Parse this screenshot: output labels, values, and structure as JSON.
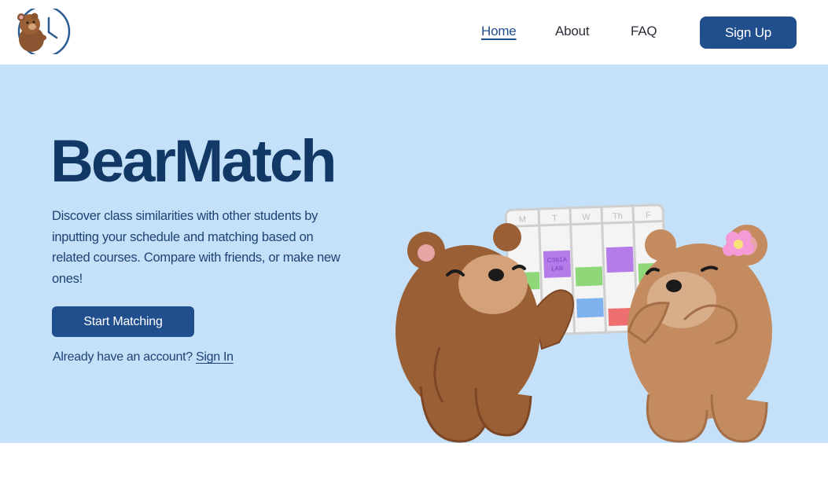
{
  "nav": {
    "logo_icon": "bear-with-clock-logo",
    "links": [
      {
        "label": "Home",
        "active": true
      },
      {
        "label": "About",
        "active": false
      },
      {
        "label": "FAQ",
        "active": false
      }
    ],
    "signup_label": "Sign Up"
  },
  "hero": {
    "title": "BearMatch",
    "description": "Discover class similarities with other students by inputting your schedule and matching based on related courses. Compare with friends, or make new ones!",
    "start_button": "Start Matching",
    "account_prompt": "Already have an account?",
    "signin_link": "Sign In",
    "illustration": {
      "calendar_days": [
        "M",
        "T",
        "W",
        "Th",
        "F"
      ],
      "event_label_line1": "CS61A",
      "event_label_line2": "LAB"
    }
  },
  "colors": {
    "primary": "#214f8d",
    "title": "#123966",
    "hero_bg": "#c5e1f9",
    "text": "#1e4274"
  }
}
